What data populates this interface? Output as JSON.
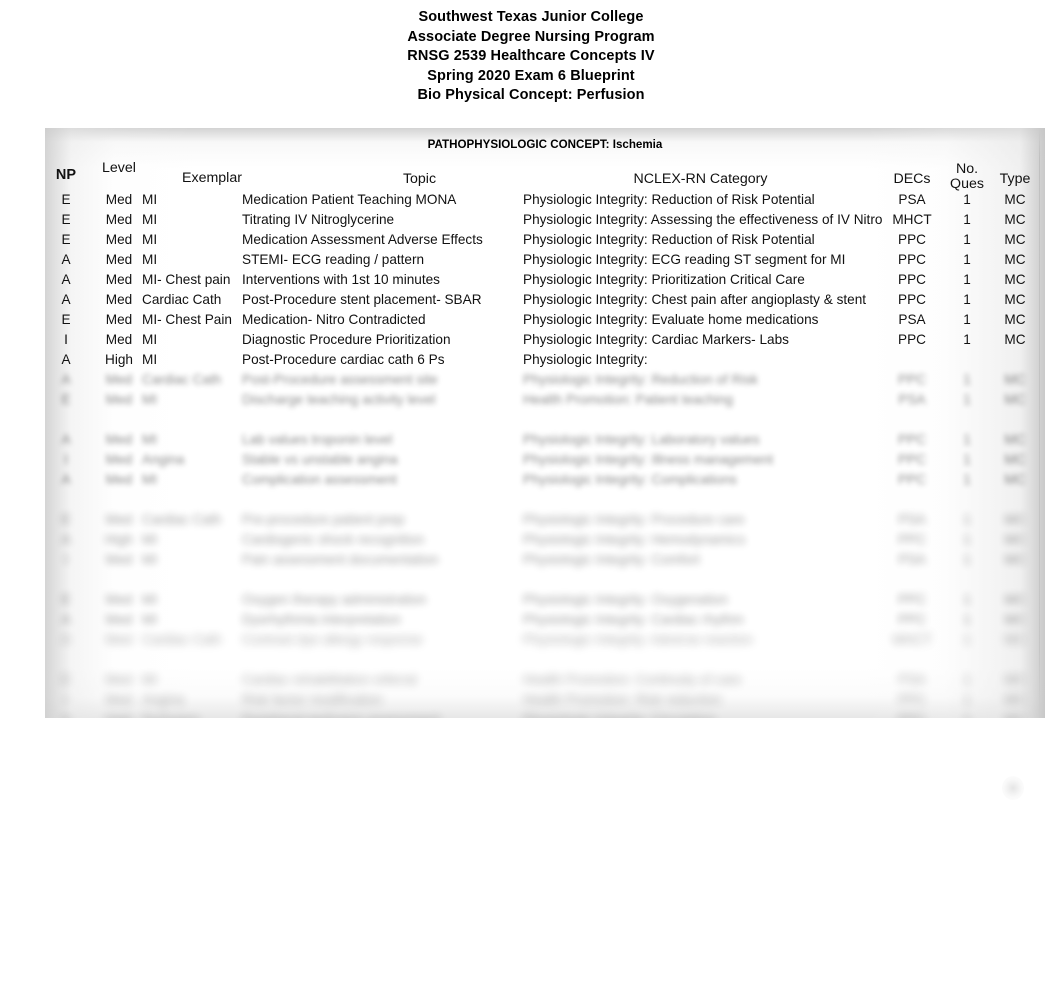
{
  "document": {
    "title_lines": [
      "Southwest Texas Junior College",
      "Associate Degree Nursing Program",
      "RNSG 2539 Healthcare Concepts IV",
      "Spring 2020 Exam 6 Blueprint",
      "Bio Physical Concept: Perfusion"
    ]
  },
  "table": {
    "banner": "PATHOPHYSIOLOGIC CONCEPT: Ischemia",
    "headers": {
      "np": "NP",
      "level": "Level",
      "exemplar": "Exemplar",
      "topic": "Topic",
      "nclex": "NCLEX-RN Category",
      "decs": "DECs",
      "ques_line1": "No.",
      "ques_line2": "Ques",
      "type": "Type",
      "extra_cut_off": ""
    },
    "rows": [
      {
        "np": "E",
        "level": "Med",
        "exemplar": "MI",
        "topic": "Medication Patient Teaching MONA",
        "nclex": "Physiologic Integrity: Reduction of Risk Potential",
        "decs": "PSA",
        "ques": "1",
        "type": "MC"
      },
      {
        "np": "E",
        "level": "Med",
        "exemplar": "MI",
        "topic": "Titrating IV Nitroglycerine",
        "nclex": "Physiologic Integrity: Assessing the effectiveness of IV Nitro",
        "decs": "MHCT",
        "ques": "1",
        "type": "MC"
      },
      {
        "np": "E",
        "level": "Med",
        "exemplar": "MI",
        "topic": "Medication Assessment Adverse Effects",
        "nclex": "Physiologic Integrity: Reduction of Risk Potential",
        "decs": "PPC",
        "ques": "1",
        "type": "MC"
      },
      {
        "np": "A",
        "level": "Med",
        "exemplar": "MI",
        "topic": "STEMI- ECG reading / pattern",
        "nclex": "Physiologic Integrity: ECG reading ST segment for MI",
        "decs": "PPC",
        "ques": "1",
        "type": "MC"
      },
      {
        "np": "A",
        "level": "Med",
        "exemplar": "MI- Chest pain",
        "topic": "Interventions with 1st 10 minutes",
        "nclex": "Physiologic Integrity: Prioritization Critical Care",
        "decs": "PPC",
        "ques": "1",
        "type": "MC"
      },
      {
        "np": "A",
        "level": "Med",
        "exemplar": "Cardiac Cath",
        "topic": "Post-Procedure stent placement- SBAR",
        "nclex": "Physiologic Integrity: Chest pain after angioplasty & stent",
        "decs": "PPC",
        "ques": "1",
        "type": "MC"
      },
      {
        "np": "E",
        "level": "Med",
        "exemplar": "MI- Chest Pain",
        "topic": "Medication- Nitro Contradicted",
        "nclex": "Physiologic Integrity: Evaluate home medications",
        "decs": "PSA",
        "ques": "1",
        "type": "MC"
      },
      {
        "np": "I",
        "level": "Med",
        "exemplar": "MI",
        "topic": "Diagnostic Procedure Prioritization",
        "nclex": "Physiologic Integrity: Cardiac Markers- Labs",
        "decs": "PPC",
        "ques": "1",
        "type": "MC"
      },
      {
        "np": "A",
        "level": "High",
        "exemplar": "MI",
        "topic": "Post-Procedure cardiac cath 6 Ps",
        "nclex": "Physiologic Integrity:",
        "decs": "",
        "ques": "",
        "type": ""
      }
    ],
    "obscured_rows": [
      {
        "np": "A",
        "level": "Med",
        "exemplar": "Cardiac Cath",
        "topic": "Post-Procedure assessment site",
        "nclex": "Physiologic Integrity: Reduction of Risk",
        "decs": "PPC",
        "ques": "1",
        "type": "MC"
      },
      {
        "np": "E",
        "level": "Med",
        "exemplar": "MI",
        "topic": "Discharge teaching activity level",
        "nclex": "Health Promotion: Patient teaching",
        "decs": "PSA",
        "ques": "1",
        "type": "MC"
      },
      {
        "np": "A",
        "level": "Med",
        "exemplar": "MI",
        "topic": "Lab values troponin level",
        "nclex": "Physiologic Integrity: Laboratory values",
        "decs": "PPC",
        "ques": "1",
        "type": "MC"
      },
      {
        "np": "I",
        "level": "Med",
        "exemplar": "Angina",
        "topic": "Stable vs unstable angina",
        "nclex": "Physiologic Integrity: Illness management",
        "decs": "PPC",
        "ques": "1",
        "type": "MC"
      },
      {
        "np": "A",
        "level": "Med",
        "exemplar": "MI",
        "topic": "Complication assessment",
        "nclex": "Physiologic Integrity: Complications",
        "decs": "PPC",
        "ques": "1",
        "type": "MC"
      },
      {
        "np": "E",
        "level": "Med",
        "exemplar": "Cardiac Cath",
        "topic": "Pre-procedure patient prep",
        "nclex": "Physiologic Integrity: Procedure care",
        "decs": "PSA",
        "ques": "1",
        "type": "MC"
      },
      {
        "np": "A",
        "level": "High",
        "exemplar": "MI",
        "topic": "Cardiogenic shock recognition",
        "nclex": "Physiologic Integrity: Hemodynamics",
        "decs": "PPC",
        "ques": "1",
        "type": "MC"
      },
      {
        "np": "I",
        "level": "Med",
        "exemplar": "MI",
        "topic": "Pain assessment documentation",
        "nclex": "Physiologic Integrity: Comfort",
        "decs": "PSA",
        "ques": "1",
        "type": "MC"
      },
      {
        "np": "E",
        "level": "Med",
        "exemplar": "MI",
        "topic": "Oxygen therapy administration",
        "nclex": "Physiologic Integrity: Oxygenation",
        "decs": "PPC",
        "ques": "1",
        "type": "MC"
      },
      {
        "np": "A",
        "level": "Med",
        "exemplar": "MI",
        "topic": "Dysrhythmia interpretation",
        "nclex": "Physiologic Integrity: Cardiac rhythm",
        "decs": "PPC",
        "ques": "1",
        "type": "MC"
      },
      {
        "np": "A",
        "level": "Med",
        "exemplar": "Cardiac Cath",
        "topic": "Contrast dye allergy response",
        "nclex": "Physiologic Integrity: Adverse reaction",
        "decs": "MHCT",
        "ques": "1",
        "type": "MC"
      },
      {
        "np": "E",
        "level": "Med",
        "exemplar": "MI",
        "topic": "Cardiac rehabilitation referral",
        "nclex": "Health Promotion: Continuity of care",
        "decs": "PSA",
        "ques": "1",
        "type": "MC"
      },
      {
        "np": "I",
        "level": "Med",
        "exemplar": "Angina",
        "topic": "Risk factor modification",
        "nclex": "Health Promotion: Risk reduction",
        "decs": "PPC",
        "ques": "1",
        "type": "MC"
      },
      {
        "np": "A",
        "level": "High",
        "exemplar": "Perfusion",
        "topic": "Peripheral perfusion assessment",
        "nclex": "Physiologic Integrity: Circulation",
        "decs": "PPC",
        "ques": "1",
        "type": "MC"
      }
    ]
  }
}
